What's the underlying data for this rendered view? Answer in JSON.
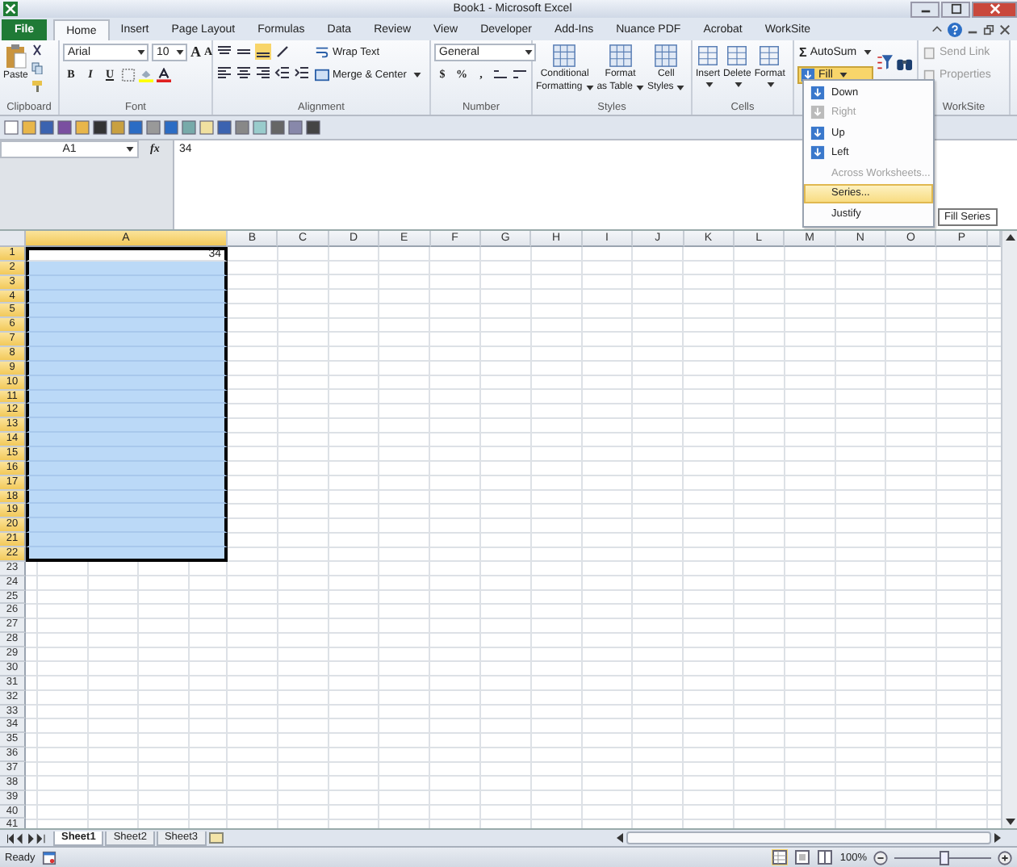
{
  "window": {
    "title": "Book1 - Microsoft Excel"
  },
  "tabs": [
    {
      "label": "File",
      "kind": "file",
      "selected": false
    },
    {
      "label": "Home",
      "kind": "tab",
      "selected": true
    },
    {
      "label": "Insert",
      "kind": "tab",
      "selected": false
    },
    {
      "label": "Page Layout",
      "kind": "tab",
      "selected": false
    },
    {
      "label": "Formulas",
      "kind": "tab",
      "selected": false
    },
    {
      "label": "Data",
      "kind": "tab",
      "selected": false
    },
    {
      "label": "Review",
      "kind": "tab",
      "selected": false
    },
    {
      "label": "View",
      "kind": "tab",
      "selected": false
    },
    {
      "label": "Developer",
      "kind": "tab",
      "selected": false
    },
    {
      "label": "Add-Ins",
      "kind": "tab",
      "selected": false
    },
    {
      "label": "Nuance PDF",
      "kind": "tab",
      "selected": false
    },
    {
      "label": "Acrobat",
      "kind": "tab",
      "selected": false
    },
    {
      "label": "WorkSite",
      "kind": "tab",
      "selected": false
    }
  ],
  "ribbon": {
    "clipboard": {
      "label": "Clipboard",
      "paste": "Paste"
    },
    "font": {
      "label": "Font",
      "font_name": "Arial",
      "font_size": "10",
      "grow": "A",
      "shrink": "A",
      "styles": [
        "B",
        "I",
        "U"
      ]
    },
    "alignment": {
      "label": "Alignment",
      "wrap_text": "Wrap Text",
      "merge": "Merge & Center"
    },
    "number": {
      "label": "Number",
      "format": "General",
      "symbols": [
        "$",
        "%",
        ","
      ]
    },
    "styles": {
      "label": "Styles",
      "buttons": [
        {
          "line1": "Conditional",
          "line2": "Formatting"
        },
        {
          "line1": "Format",
          "line2": "as Table"
        },
        {
          "line1": "Cell",
          "line2": "Styles"
        }
      ]
    },
    "cells": {
      "label": "Cells",
      "buttons": [
        "Insert",
        "Delete",
        "Format"
      ]
    },
    "editing": {
      "autosum_symbol": "Σ",
      "autosum": "AutoSum",
      "fill": "Fill",
      "fill_open": true
    },
    "worksite": {
      "label": "WorkSite",
      "buttons": [
        {
          "label": "Send Link",
          "disabled": true
        },
        {
          "label": "Properties",
          "disabled": true
        }
      ]
    }
  },
  "formula_bar": {
    "name_box": "A1",
    "fx": "fx",
    "value": "34"
  },
  "sheet": {
    "columns": [
      {
        "label": "A",
        "selected": true
      },
      {
        "label": "B",
        "selected": false
      },
      {
        "label": "C",
        "selected": false
      },
      {
        "label": "D",
        "selected": false
      },
      {
        "label": "E",
        "selected": false
      },
      {
        "label": "F",
        "selected": false
      },
      {
        "label": "G",
        "selected": false
      },
      {
        "label": "H",
        "selected": false
      },
      {
        "label": "I",
        "selected": false
      },
      {
        "label": "J",
        "selected": false
      },
      {
        "label": "K",
        "selected": false
      },
      {
        "label": "L",
        "selected": false
      },
      {
        "label": "M",
        "selected": false
      },
      {
        "label": "N",
        "selected": false
      },
      {
        "label": "O",
        "selected": false
      },
      {
        "label": "P",
        "selected": false
      }
    ],
    "rows": [
      {
        "label": "1",
        "selected": true,
        "cells": [
          {
            "value": "34",
            "active": true
          }
        ]
      },
      {
        "label": "2",
        "selected": true
      },
      {
        "label": "3",
        "selected": true
      },
      {
        "label": "4",
        "selected": true
      },
      {
        "label": "5",
        "selected": true
      },
      {
        "label": "6",
        "selected": true
      },
      {
        "label": "7",
        "selected": true
      },
      {
        "label": "8",
        "selected": true
      },
      {
        "label": "9",
        "selected": true
      },
      {
        "label": "10",
        "selected": true
      },
      {
        "label": "11",
        "selected": true
      },
      {
        "label": "12",
        "selected": true
      },
      {
        "label": "13",
        "selected": true
      },
      {
        "label": "14",
        "selected": true
      },
      {
        "label": "15",
        "selected": true
      },
      {
        "label": "16",
        "selected": true
      },
      {
        "label": "17",
        "selected": true
      },
      {
        "label": "18",
        "selected": true
      },
      {
        "label": "19",
        "selected": true
      },
      {
        "label": "20",
        "selected": true
      },
      {
        "label": "21",
        "selected": true
      },
      {
        "label": "22",
        "selected": true
      },
      {
        "label": "23",
        "selected": false
      },
      {
        "label": "24",
        "selected": false
      },
      {
        "label": "25",
        "selected": false
      },
      {
        "label": "26",
        "selected": false
      },
      {
        "label": "27",
        "selected": false
      },
      {
        "label": "28",
        "selected": false
      },
      {
        "label": "29",
        "selected": false
      },
      {
        "label": "30",
        "selected": false
      },
      {
        "label": "31",
        "selected": false
      },
      {
        "label": "32",
        "selected": false
      },
      {
        "label": "33",
        "selected": false
      },
      {
        "label": "34",
        "selected": false
      },
      {
        "label": "35",
        "selected": false
      },
      {
        "label": "36",
        "selected": false
      },
      {
        "label": "37",
        "selected": false
      },
      {
        "label": "38",
        "selected": false
      },
      {
        "label": "39",
        "selected": false
      },
      {
        "label": "40",
        "selected": false
      },
      {
        "label": "41",
        "selected": false
      }
    ]
  },
  "sheet_tabs": [
    {
      "label": "Sheet1",
      "selected": true
    },
    {
      "label": "Sheet2",
      "selected": false
    },
    {
      "label": "Sheet3",
      "selected": false
    }
  ],
  "status_bar": {
    "status": "Ready",
    "zoom": "100%",
    "zoom_slider": {
      "level": 0.5
    }
  },
  "fill_menu": {
    "items": [
      {
        "label": "Down",
        "disabled": false,
        "selected": false,
        "icon": true
      },
      {
        "label": "Right",
        "disabled": true,
        "selected": false,
        "icon": true
      },
      {
        "label": "Up",
        "disabled": false,
        "selected": false,
        "icon": true
      },
      {
        "label": "Left",
        "disabled": false,
        "selected": false,
        "icon": true
      },
      {
        "label": "Across Worksheets...",
        "disabled": true,
        "selected": false,
        "icon": false
      },
      {
        "label": "Series...",
        "disabled": false,
        "selected": true,
        "icon": false
      },
      {
        "label": "Justify",
        "disabled": false,
        "selected": false,
        "icon": false
      }
    ],
    "tooltip": "Fill Series"
  }
}
